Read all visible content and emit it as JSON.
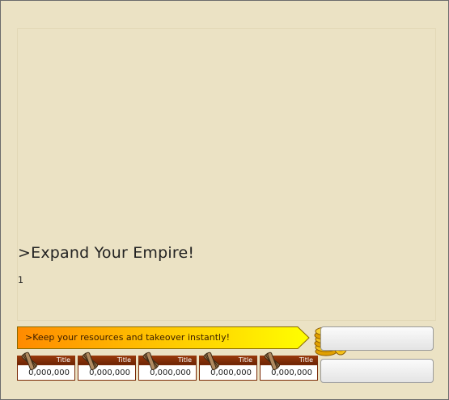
{
  "headline": ">Expand Your Empire!",
  "subline": "1",
  "promo": {
    "text": ">Keep your resources and takeover instantly!",
    "icon": "gold-coins-icon"
  },
  "resources": [
    {
      "title": "Title",
      "value": "0,000,000",
      "icon": "lumber-icon"
    },
    {
      "title": "Title",
      "value": "0,000,000",
      "icon": "lumber-icon"
    },
    {
      "title": "Title",
      "value": "0,000,000",
      "icon": "lumber-icon"
    },
    {
      "title": "Title",
      "value": "0,000,000",
      "icon": "lumber-icon"
    },
    {
      "title": "Title",
      "value": "0,000,000",
      "icon": "lumber-icon"
    }
  ],
  "buttons": {
    "top_label": "",
    "bottom_label": ""
  },
  "colors": {
    "background": "#ebe2c4",
    "banner_start": "#ff8a00",
    "banner_end": "#ffff00",
    "resource_header": "#8a300a"
  }
}
